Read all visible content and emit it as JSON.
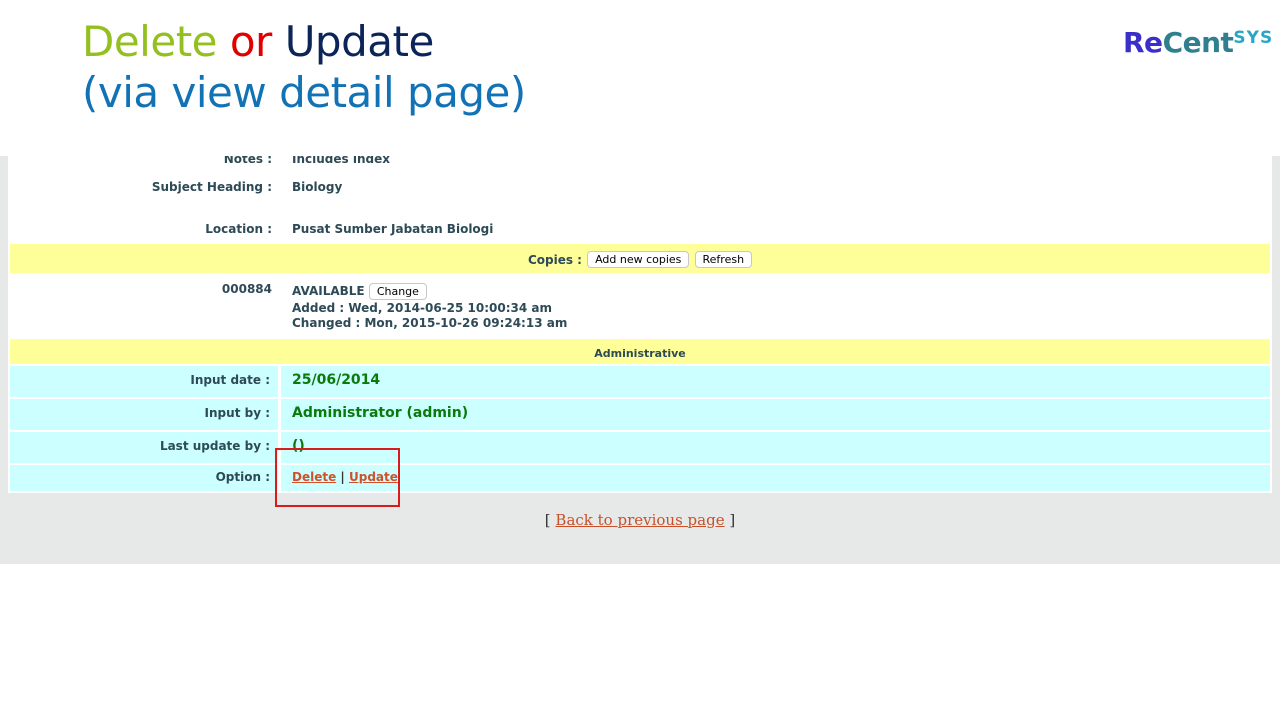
{
  "slide": {
    "title_delete": "Delete",
    "title_or": "or",
    "title_update": "Update",
    "subtitle": "(via view detail page)"
  },
  "logo": {
    "re": "Re",
    "cent": "Cent",
    "sys": "SYS"
  },
  "details": {
    "notes_label": "Notes :",
    "notes_value": "Includes index",
    "subject_label": "Subject Heading :",
    "subject_value": "Biology",
    "location_label": "Location :",
    "location_value": "Pusat Sumber Jabatan Biologi"
  },
  "copies": {
    "label": "Copies :",
    "add_button": "Add new copies",
    "refresh_button": "Refresh",
    "item_id": "000884",
    "status": "AVAILABLE",
    "change_button": "Change",
    "added": "Added : Wed, 2014-06-25 10:00:34 am",
    "changed": "Changed : Mon, 2015-10-26 09:24:13 am"
  },
  "admin": {
    "header": "Administrative",
    "input_date_label": "Input date :",
    "input_date_value": "25/06/2014",
    "input_by_label": "Input by :",
    "input_by_value": "Administrator (admin)",
    "last_update_label": "Last update by :",
    "last_update_value": "()",
    "option_label": "Option :",
    "delete_link": "Delete",
    "separator": "|",
    "update_link": "Update"
  },
  "footer": {
    "open_bracket": "[",
    "back_link": "Back to previous page",
    "close_bracket": "]"
  },
  "colors": {
    "yellow_bar": "#ffff99",
    "cyan_row": "#ccffff",
    "highlight": "#d81b1b"
  }
}
